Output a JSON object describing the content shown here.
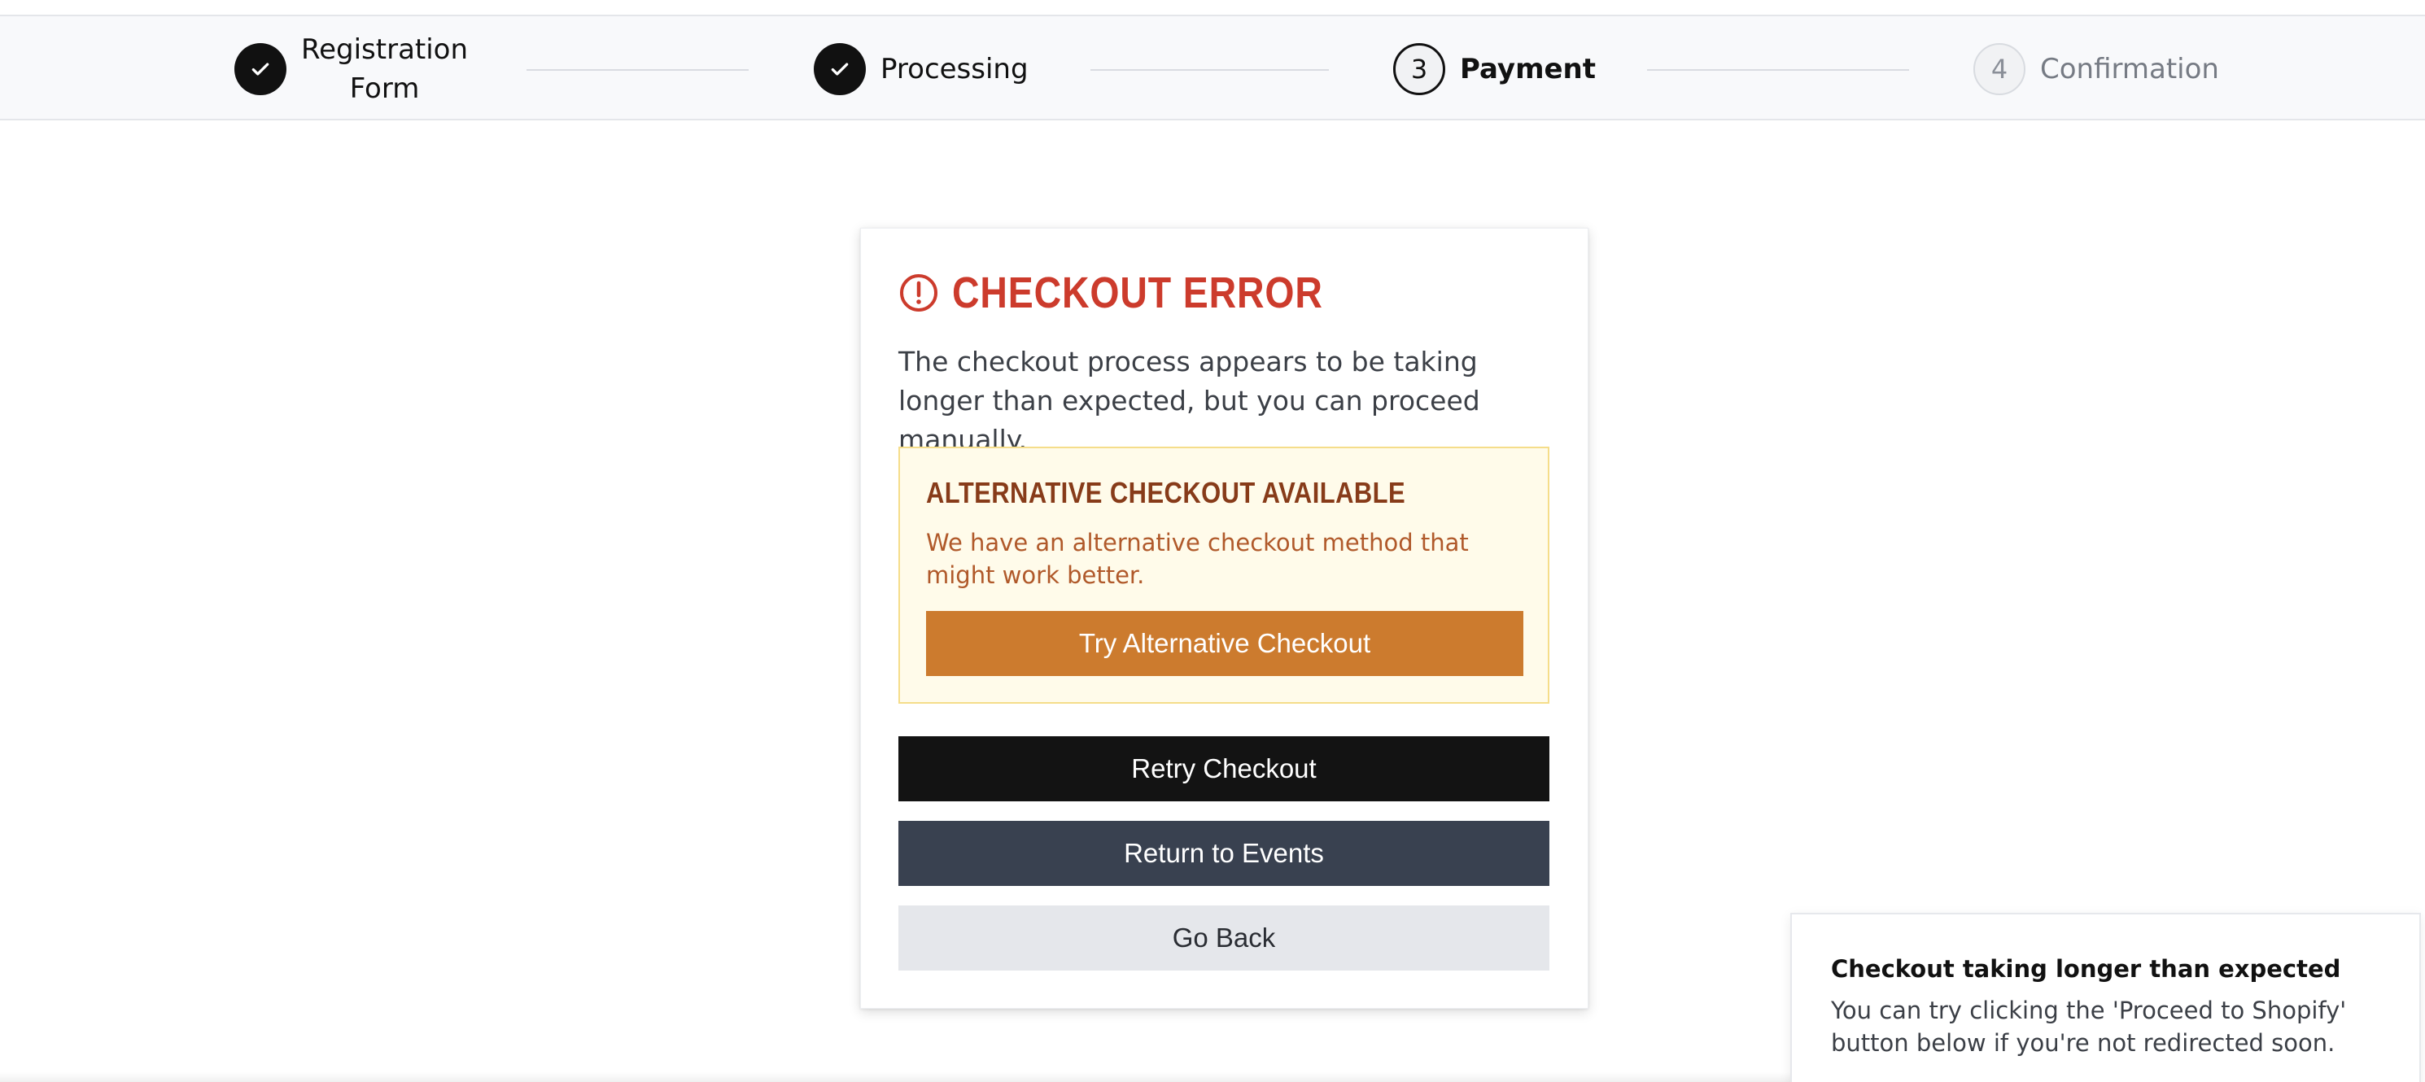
{
  "stepper": {
    "steps": [
      {
        "label": "Registration Form",
        "state": "completed",
        "indicator": "check-icon"
      },
      {
        "label": "Processing",
        "state": "completed",
        "indicator": "check-icon"
      },
      {
        "label": "Payment",
        "state": "current",
        "number": "3"
      },
      {
        "label": "Confirmation",
        "state": "upcoming",
        "number": "4"
      }
    ],
    "label_lines": {
      "registration_line1": "Registration",
      "registration_line2": "Form"
    }
  },
  "error_card": {
    "icon": "alert-circle-icon",
    "title": "CHECKOUT ERROR",
    "message": "The checkout process appears to be taking longer than expected, but you can proceed manually.",
    "alternative": {
      "title": "ALTERNATIVE CHECKOUT AVAILABLE",
      "description": "We have an alternative checkout method that might work better.",
      "button_label": "Try Alternative Checkout"
    },
    "retry_label": "Retry Checkout",
    "return_label": "Return to Events",
    "back_label": "Go Back"
  },
  "toast": {
    "title": "Checkout taking longer than expected",
    "message": "You can try clicking the 'Proceed to Shopify' button below if you're not redirected soon."
  },
  "colors": {
    "error_red": "#cc3b2c",
    "alt_bg": "#fffbea",
    "alt_border": "#f5dd8a",
    "alt_title": "#873b19",
    "alt_text": "#b0592a",
    "alt_button": "#cc7b2e",
    "retry_button": "#131313",
    "return_button": "#394150",
    "back_button": "#e5e7eb"
  }
}
